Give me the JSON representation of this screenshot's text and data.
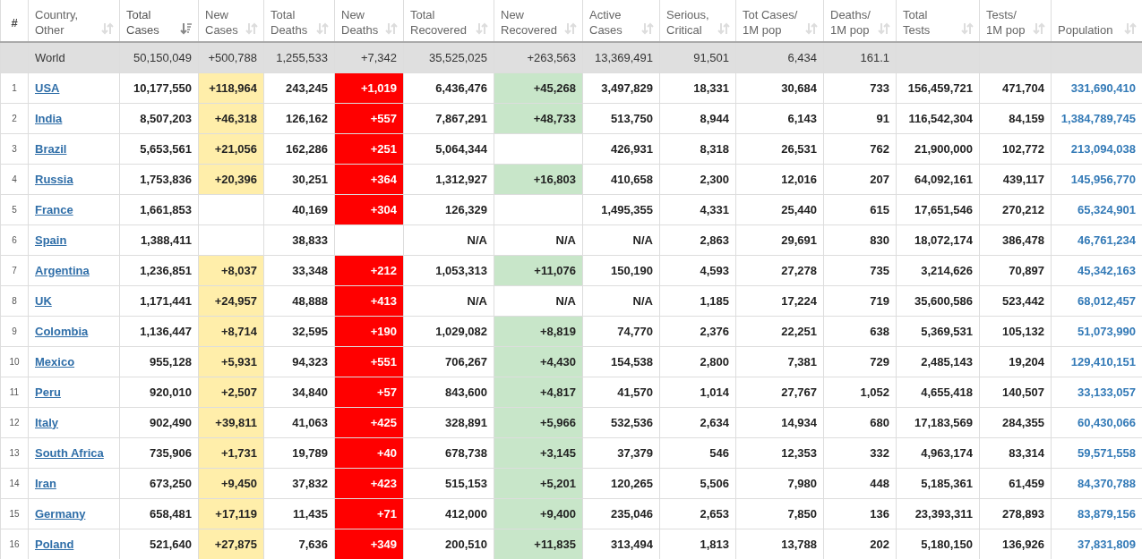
{
  "table": {
    "columns": [
      {
        "heading": [
          "#"
        ],
        "kind": "rank"
      },
      {
        "heading": [
          "Country,",
          "Other"
        ],
        "kind": "country",
        "sorted": false
      },
      {
        "heading": [
          "Total",
          "Cases"
        ],
        "kind": "number",
        "sorted": true
      },
      {
        "heading": [
          "New",
          "Cases"
        ],
        "kind": "new_cases",
        "sorted": false
      },
      {
        "heading": [
          "Total",
          "Deaths"
        ],
        "kind": "number",
        "sorted": false
      },
      {
        "heading": [
          "New",
          "Deaths"
        ],
        "kind": "new_deaths",
        "sorted": false
      },
      {
        "heading": [
          "Total",
          "Recovered"
        ],
        "kind": "number",
        "sorted": false
      },
      {
        "heading": [
          "New",
          "Recovered"
        ],
        "kind": "new_recovered",
        "sorted": false
      },
      {
        "heading": [
          "Active",
          "Cases"
        ],
        "kind": "number",
        "sorted": false
      },
      {
        "heading": [
          "Serious,",
          "Critical"
        ],
        "kind": "number",
        "sorted": false
      },
      {
        "heading": [
          "Tot Cases/",
          "1M pop"
        ],
        "kind": "number",
        "sorted": false
      },
      {
        "heading": [
          "Deaths/",
          "1M pop"
        ],
        "kind": "number",
        "sorted": false
      },
      {
        "heading": [
          "Total",
          "Tests"
        ],
        "kind": "number",
        "sorted": false
      },
      {
        "heading": [
          "Tests/",
          "1M pop"
        ],
        "kind": "number",
        "sorted": false
      },
      {
        "heading": [
          "Population"
        ],
        "kind": "population",
        "sorted": false
      }
    ],
    "total_row": {
      "label": "World",
      "values": [
        "50,150,049",
        "+500,788",
        "1,255,533",
        "+7,342",
        "35,525,025",
        "+263,563",
        "13,369,491",
        "91,501",
        "6,434",
        "161.1"
      ]
    },
    "rows": [
      [
        "1",
        "USA",
        "10,177,550",
        "+118,964",
        "243,245",
        "+1,019",
        "6,436,476",
        "+45,268",
        "3,497,829",
        "18,331",
        "30,684",
        "733",
        "156,459,721",
        "471,704",
        "331,690,410"
      ],
      [
        "2",
        "India",
        "8,507,203",
        "+46,318",
        "126,162",
        "+557",
        "7,867,291",
        "+48,733",
        "513,750",
        "8,944",
        "6,143",
        "91",
        "116,542,304",
        "84,159",
        "1,384,789,745"
      ],
      [
        "3",
        "Brazil",
        "5,653,561",
        "+21,056",
        "162,286",
        "+251",
        "5,064,344",
        null,
        "426,931",
        "8,318",
        "26,531",
        "762",
        "21,900,000",
        "102,772",
        "213,094,038"
      ],
      [
        "4",
        "Russia",
        "1,753,836",
        "+20,396",
        "30,251",
        "+364",
        "1,312,927",
        "+16,803",
        "410,658",
        "2,300",
        "12,016",
        "207",
        "64,092,161",
        "439,117",
        "145,956,770"
      ],
      [
        "5",
        "France",
        "1,661,853",
        null,
        "40,169",
        "+304",
        "126,329",
        null,
        "1,495,355",
        "4,331",
        "25,440",
        "615",
        "17,651,546",
        "270,212",
        "65,324,901"
      ],
      [
        "6",
        "Spain",
        "1,388,411",
        null,
        "38,833",
        null,
        "N/A",
        {
          "text": "N/A",
          "highlight": false
        },
        "N/A",
        "2,863",
        "29,691",
        "830",
        "18,072,174",
        "386,478",
        "46,761,234"
      ],
      [
        "7",
        "Argentina",
        "1,236,851",
        "+8,037",
        "33,348",
        "+212",
        "1,053,313",
        "+11,076",
        "150,190",
        "4,593",
        "27,278",
        "735",
        "3,214,626",
        "70,897",
        "45,342,163"
      ],
      [
        "8",
        "UK",
        "1,171,441",
        "+24,957",
        "48,888",
        "+413",
        "N/A",
        {
          "text": "N/A",
          "highlight": false
        },
        "N/A",
        "1,185",
        "17,224",
        "719",
        "35,600,586",
        "523,442",
        "68,012,457"
      ],
      [
        "9",
        "Colombia",
        "1,136,447",
        "+8,714",
        "32,595",
        "+190",
        "1,029,082",
        "+8,819",
        "74,770",
        "2,376",
        "22,251",
        "638",
        "5,369,531",
        "105,132",
        "51,073,990"
      ],
      [
        "10",
        "Mexico",
        "955,128",
        "+5,931",
        "94,323",
        "+551",
        "706,267",
        "+4,430",
        "154,538",
        "2,800",
        "7,381",
        "729",
        "2,485,143",
        "19,204",
        "129,410,151"
      ],
      [
        "11",
        "Peru",
        "920,010",
        "+2,507",
        "34,840",
        "+57",
        "843,600",
        "+4,817",
        "41,570",
        "1,014",
        "27,767",
        "1,052",
        "4,655,418",
        "140,507",
        "33,133,057"
      ],
      [
        "12",
        "Italy",
        "902,490",
        "+39,811",
        "41,063",
        "+425",
        "328,891",
        "+5,966",
        "532,536",
        "2,634",
        "14,934",
        "680",
        "17,183,569",
        "284,355",
        "60,430,066"
      ],
      [
        "13",
        "South Africa",
        "735,906",
        "+1,731",
        "19,789",
        "+40",
        "678,738",
        "+3,145",
        "37,379",
        "546",
        "12,353",
        "332",
        "4,963,174",
        "83,314",
        "59,571,558"
      ],
      [
        "14",
        "Iran",
        "673,250",
        "+9,450",
        "37,832",
        "+423",
        "515,153",
        "+5,201",
        "120,265",
        "5,506",
        "7,980",
        "448",
        "5,185,361",
        "61,459",
        "84,370,788"
      ],
      [
        "15",
        "Germany",
        "658,481",
        "+17,119",
        "11,435",
        "+71",
        "412,000",
        "+9,400",
        "235,046",
        "2,653",
        "7,850",
        "136",
        "23,393,311",
        "278,893",
        "83,879,156"
      ],
      [
        "16",
        "Poland",
        "521,640",
        "+27,875",
        "7,636",
        "+349",
        "200,510",
        "+11,835",
        "313,494",
        "1,813",
        "13,788",
        "202",
        "5,180,150",
        "136,926",
        "37,831,809"
      ]
    ]
  }
}
